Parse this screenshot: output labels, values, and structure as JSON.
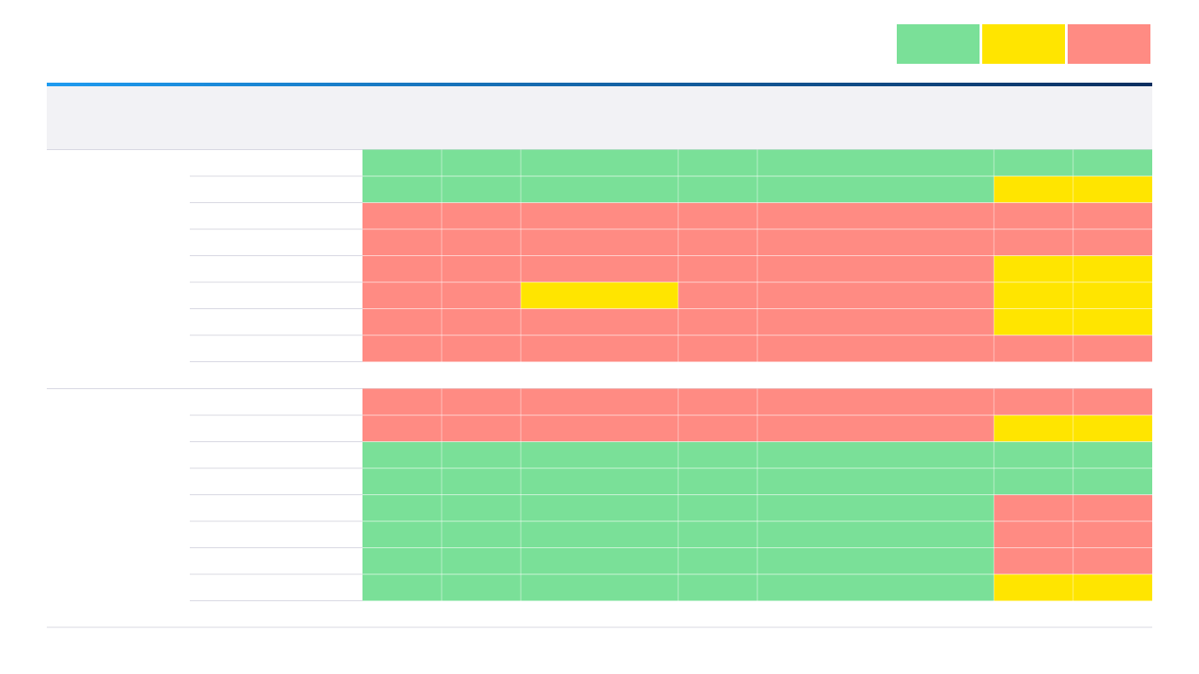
{
  "legend": [
    {
      "color": "#7ae098"
    },
    {
      "color": "#ffe500"
    },
    {
      "color": "#ff8b83"
    }
  ],
  "colors": {
    "g": "#7ae098",
    "y": "#ffe500",
    "r": "#ff8b83",
    "accent_start": "#1e9bf0",
    "accent_end": "#0b2e5f",
    "header_bg": "#f2f2f5",
    "rule": "#d8d8e2"
  },
  "chart_data": {
    "type": "heatmap",
    "title": "",
    "groups": [
      {
        "name": "",
        "rows": [
          [
            "g",
            "g",
            "g",
            "g",
            "g",
            "g",
            "g"
          ],
          [
            "g",
            "g",
            "g",
            "g",
            "g",
            "y",
            "y"
          ],
          [
            "r",
            "r",
            "r",
            "r",
            "r",
            "r",
            "r"
          ],
          [
            "r",
            "r",
            "r",
            "r",
            "r",
            "r",
            "r"
          ],
          [
            "r",
            "r",
            "r",
            "r",
            "r",
            "y",
            "y"
          ],
          [
            "r",
            "r",
            "y",
            "r",
            "r",
            "y",
            "y"
          ],
          [
            "r",
            "r",
            "r",
            "r",
            "r",
            "y",
            "y"
          ],
          [
            "r",
            "r",
            "r",
            "r",
            "r",
            "r",
            "r"
          ]
        ]
      },
      {
        "name": "",
        "rows": [
          [
            "r",
            "r",
            "r",
            "r",
            "r",
            "r",
            "r"
          ],
          [
            "r",
            "r",
            "r",
            "r",
            "r",
            "y",
            "y"
          ],
          [
            "g",
            "g",
            "g",
            "g",
            "g",
            "g",
            "g"
          ],
          [
            "g",
            "g",
            "g",
            "g",
            "g",
            "g",
            "g"
          ],
          [
            "g",
            "g",
            "g",
            "g",
            "g",
            "r",
            "r"
          ],
          [
            "g",
            "g",
            "g",
            "g",
            "g",
            "r",
            "r"
          ],
          [
            "g",
            "g",
            "g",
            "g",
            "g",
            "r",
            "r"
          ],
          [
            "g",
            "g",
            "g",
            "g",
            "g",
            "y",
            "y"
          ]
        ]
      }
    ]
  }
}
